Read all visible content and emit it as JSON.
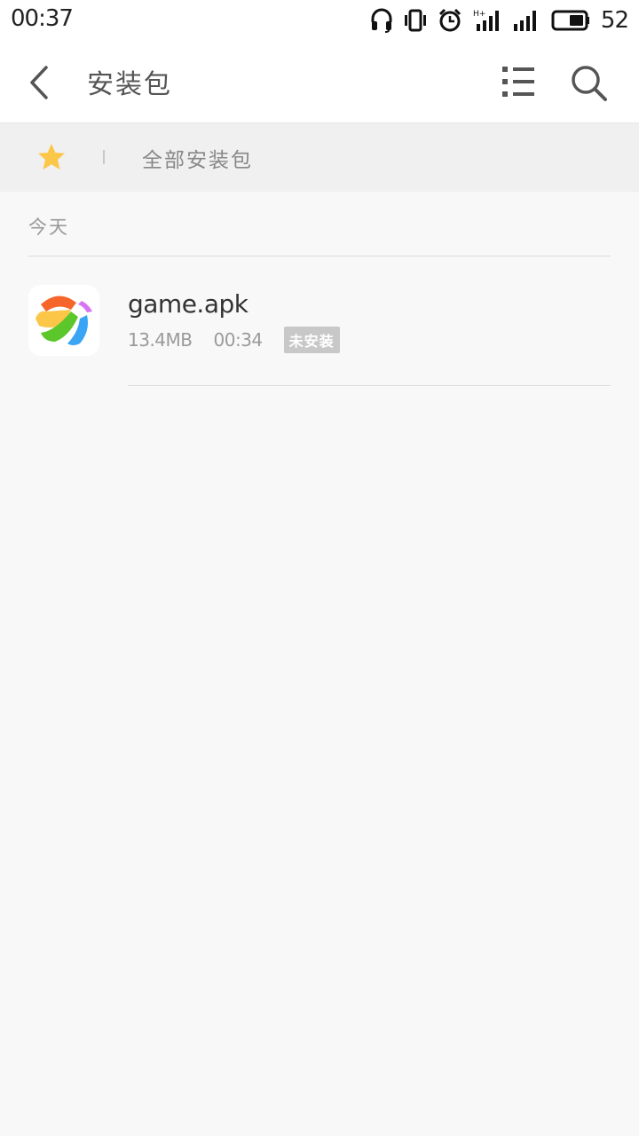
{
  "status_bar": {
    "time": "00:37",
    "battery_level": "52",
    "icons": [
      "headset-icon",
      "vibrate-icon",
      "alarm-icon",
      "signal-hplus-icon",
      "signal-icon",
      "battery-icon"
    ]
  },
  "app_bar": {
    "title": "安装包",
    "icons": {
      "back": "chevron-left-icon",
      "list": "list-view-icon",
      "search": "search-icon"
    }
  },
  "filter_bar": {
    "favorite_icon": "star-icon",
    "label": "全部安装包"
  },
  "sections": [
    {
      "header": "今天",
      "items": [
        {
          "name": "game.apk",
          "size": "13.4MB",
          "time": "00:34",
          "status": "未安装",
          "icon": "app-store-icon"
        }
      ]
    }
  ],
  "colors": {
    "star": "#fcc649",
    "status_badge": "#c8c8c8",
    "background": "#f8f8f8"
  }
}
